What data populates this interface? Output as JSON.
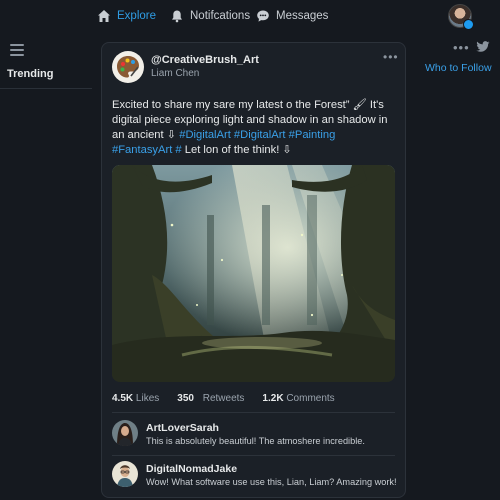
{
  "nav": {
    "explore_label": "Explore",
    "notifications_label": "Notifcations",
    "messages_label": "Messages",
    "active_color": "#2f9de4"
  },
  "sidebar_left": {
    "trending_label": "Trending"
  },
  "sidebar_right": {
    "more_label": "•••",
    "who_to_follow_label": "Who to Follow"
  },
  "post": {
    "author_handle": "@CreativeBrush_Art",
    "author_name": "Liam Chen",
    "more_label": "•••",
    "text_main": "Excited to share my sare my latest o the Forest” 🖌 It's digital piece exploring light and shadow in an shadow in an ancient ⇩ ",
    "hashtags": "#DigitalArt #DigitalArt #Painting #FantasyArt #",
    "text_end": " Let lon of the think! ⇩",
    "image_description_icon": "forest-painting-image",
    "likes_count": "4.5K",
    "likes_label": "Likes",
    "retweets_count": "350",
    "retweets_label": "Retweets",
    "comments_count": "1.2K",
    "comments_label": "Comments"
  },
  "comments": [
    {
      "name": "ArtLoverSarah",
      "text": "This is absolutely beautiful! The atmoshere incredible."
    },
    {
      "name": "DigitalNomadJake",
      "text": "Wow! What software use use this, Lian, Liam? Amazing work!"
    }
  ],
  "colors": {
    "background": "#15191f",
    "card": "#1b2027",
    "link": "#3aa0e8"
  }
}
